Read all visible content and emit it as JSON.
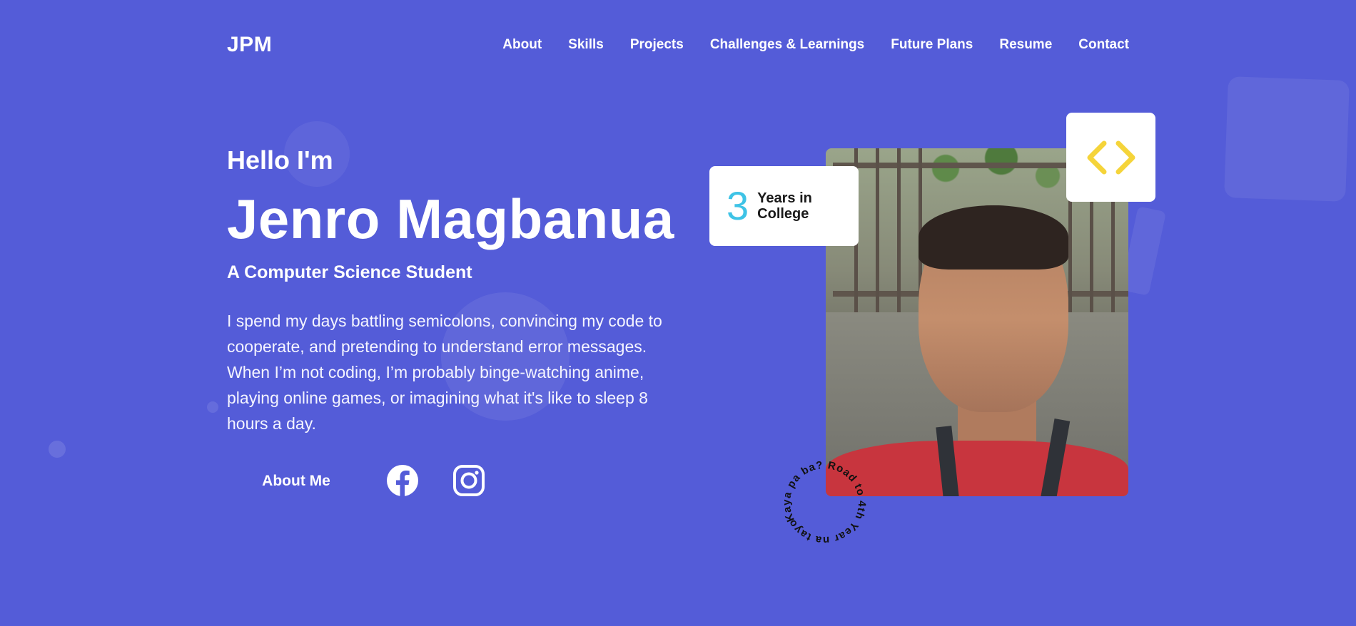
{
  "brand": {
    "logo": "JPM",
    "accent": "#545cd8",
    "highlight": "#3ec3e6",
    "code_color": "#f5d43a"
  },
  "nav": {
    "items": [
      {
        "label": "About"
      },
      {
        "label": "Skills"
      },
      {
        "label": "Projects"
      },
      {
        "label": "Challenges & Learnings"
      },
      {
        "label": "Future Plans"
      },
      {
        "label": "Resume"
      },
      {
        "label": "Contact"
      }
    ]
  },
  "hero": {
    "greeting": "Hello I'm",
    "name": "Jenro Magbanua",
    "role": "A Computer Science Student",
    "bio": "I spend my days battling semicolons, convincing my code to cooperate, and pretending to understand error messages. When I’m not coding, I’m probably binge-watching anime, playing online games, or imagining what it's like to sleep 8 hours a day.",
    "cta_label": "About Me",
    "social": [
      {
        "icon": "facebook-icon"
      },
      {
        "icon": "instagram-icon"
      }
    ]
  },
  "stats": {
    "years_value": "3",
    "years_label": "Years in College"
  },
  "badge": {
    "circular_text": "Kaya pa ba? Road to 4th Year na tayo."
  },
  "code_card": {
    "icon": "code-brackets-icon"
  }
}
